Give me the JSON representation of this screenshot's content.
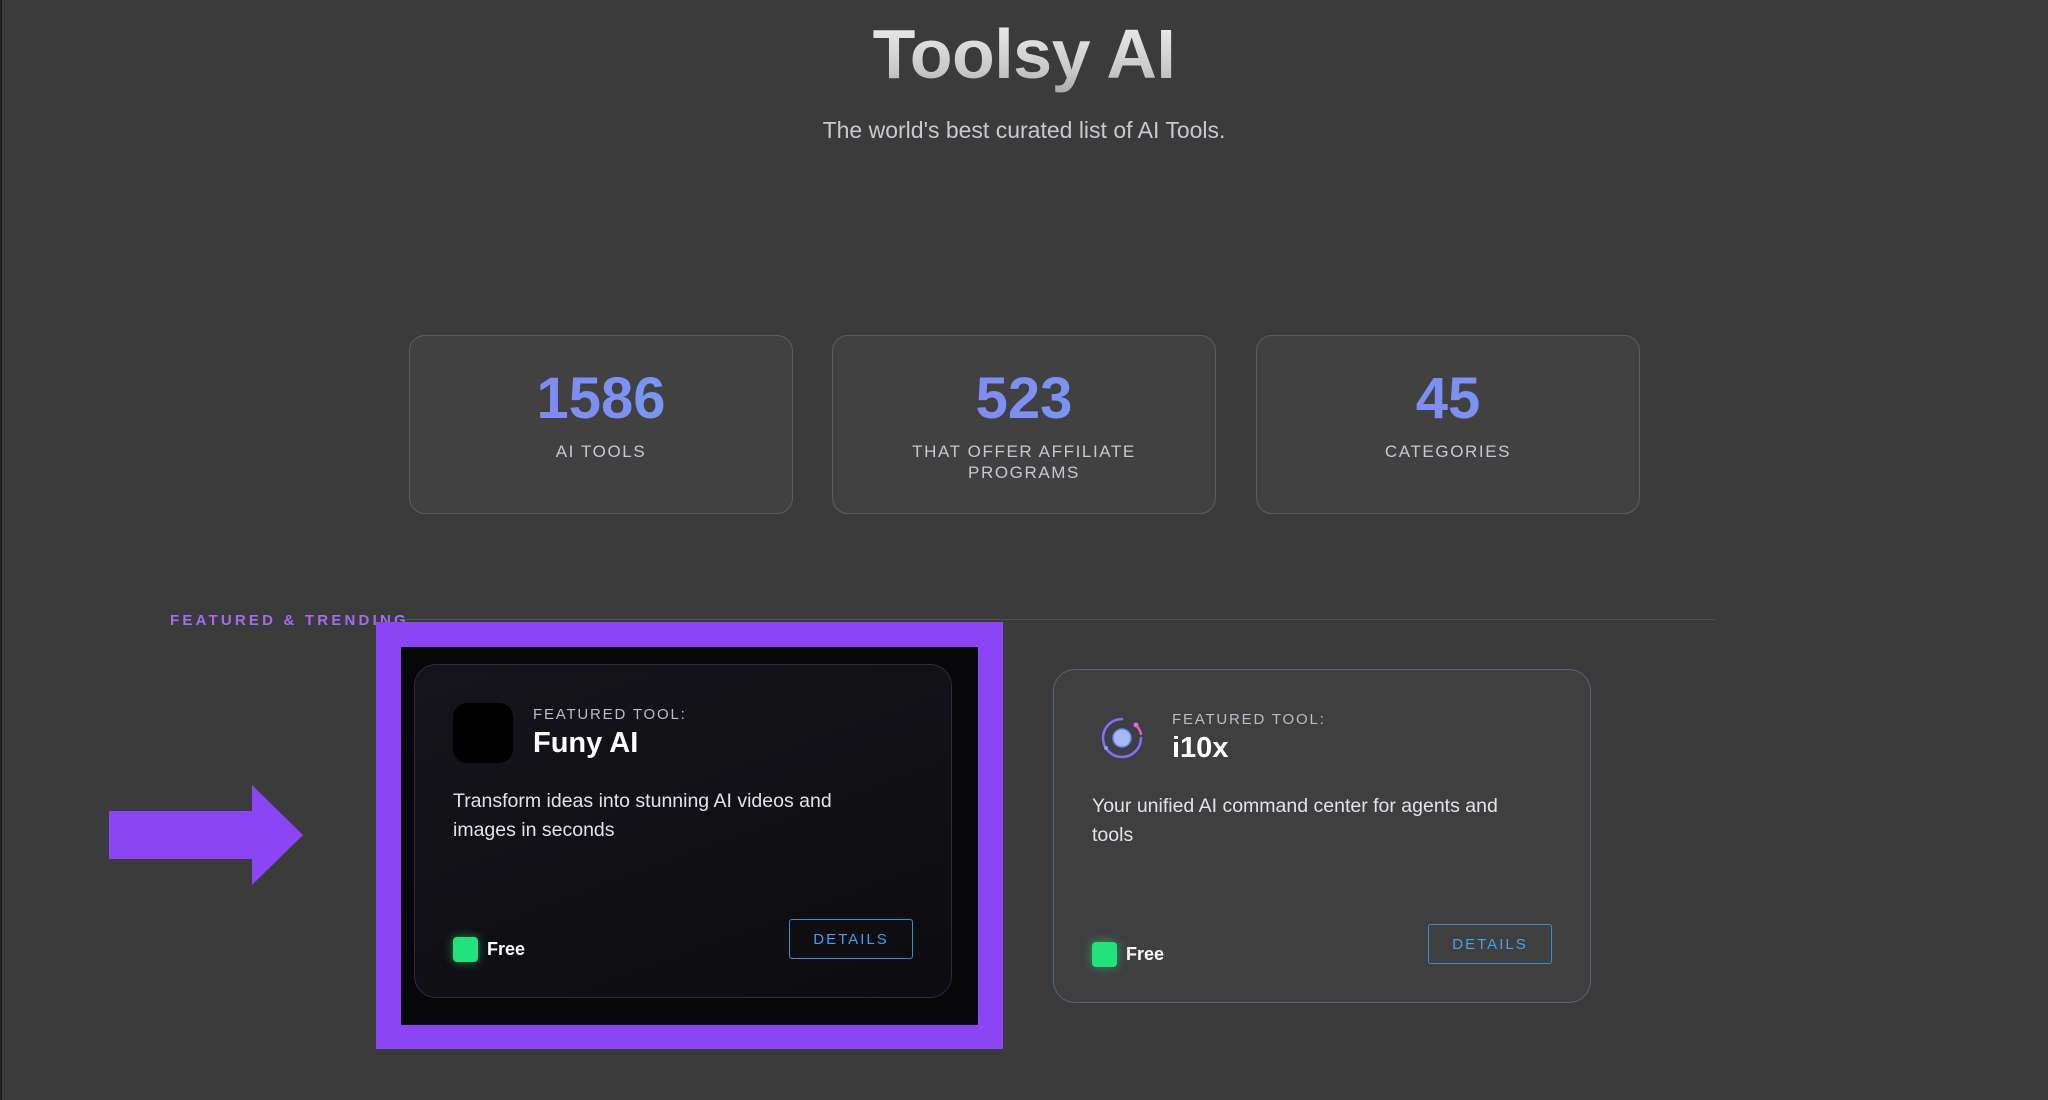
{
  "hero": {
    "title": "Toolsy AI",
    "subtitle": "The world's best curated list of AI Tools."
  },
  "stats": [
    {
      "value": "1586",
      "label": "AI TOOLS"
    },
    {
      "value": "523",
      "label": "THAT OFFER AFFILIATE PROGRAMS"
    },
    {
      "value": "45",
      "label": "CATEGORIES"
    }
  ],
  "featured": {
    "section_label": "FEATURED & TRENDING",
    "tools": [
      {
        "eyebrow": "FEATURED TOOL:",
        "name": "Funy AI",
        "description": "Transform ideas into stunning AI videos and images in seconds",
        "pricing": "Free",
        "details_label": "DETAILS",
        "icon": "black-square-logo"
      },
      {
        "eyebrow": "FEATURED TOOL:",
        "name": "i10x",
        "description": "Your unified AI command center for agents and tools",
        "pricing": "Free",
        "details_label": "DETAILS",
        "icon": "orbit-logo"
      }
    ]
  },
  "annotation": {
    "arrow_icon": "right-arrow-icon",
    "highlight_color": "#8b45f5"
  },
  "colors": {
    "background": "#3b3b3c",
    "accent_purple": "#a46bf0",
    "stat_gradient_start": "#8b7cf5",
    "stat_gradient_end": "#6ea4f0",
    "free_badge": "#22e27b",
    "details_blue": "#3ea2ee"
  }
}
